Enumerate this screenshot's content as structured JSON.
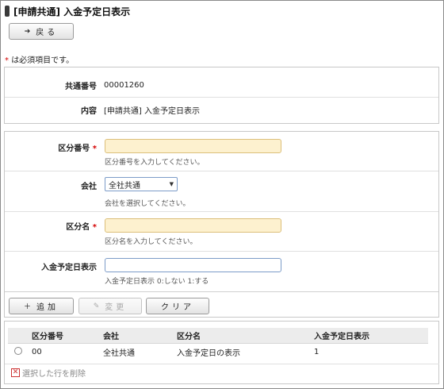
{
  "page": {
    "title": "[申請共通] 入金予定日表示"
  },
  "toolbar": {
    "back_label": "戻る",
    "back_icon": "arrow-left-icon"
  },
  "required_note": {
    "mark": "*",
    "text": "は必須項目です。"
  },
  "info": {
    "common_no_label": "共通番号",
    "common_no_value": "00001260",
    "content_label": "内容",
    "content_value": "[申請共通] 入金予定日表示"
  },
  "form": {
    "kubun_no": {
      "label": "区分番号",
      "required_mark": "*",
      "value": "",
      "help": "区分番号を入力してください。"
    },
    "company": {
      "label": "会社",
      "selected": "全社共通",
      "help": "会社を選択してください。"
    },
    "kubun_name": {
      "label": "区分名",
      "required_mark": "*",
      "value": "",
      "help": "区分名を入力してください。"
    },
    "display": {
      "label": "入金予定日表示",
      "value": "",
      "help": "入金予定日表示 0:しない 1:する"
    }
  },
  "actions": {
    "add_label": "追加",
    "change_label": "変更",
    "clear_label": "クリア"
  },
  "table": {
    "headers": [
      "区分番号",
      "会社",
      "区分名",
      "入金予定日表示"
    ],
    "rows": [
      {
        "kubun_no": "00",
        "company": "全社共通",
        "kubun_name": "入金予定日の表示",
        "display": "1"
      }
    ]
  },
  "delete_label": "選択した行を削除",
  "colors": {
    "required": "#d40000",
    "required_field_bg": "#fdf1cf"
  }
}
